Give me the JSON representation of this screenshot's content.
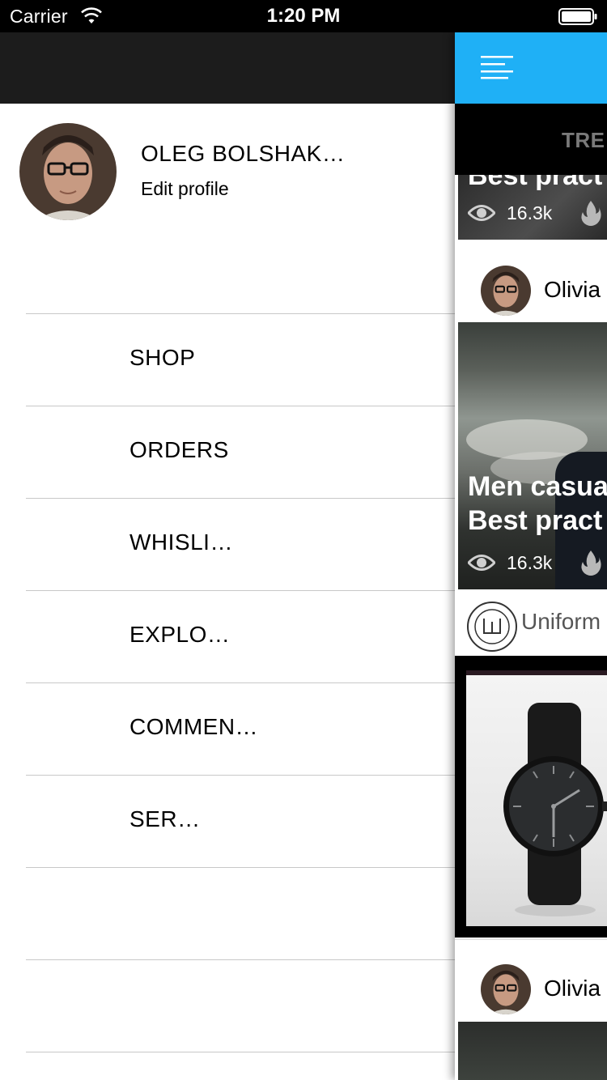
{
  "status_bar": {
    "carrier": "Carrier",
    "time": "1:20 PM"
  },
  "drawer": {
    "profile": {
      "name": "OLEG BOLSHAK…",
      "edit_label": "Edit profile"
    },
    "menu": [
      {
        "label": "SHOP"
      },
      {
        "label": "ORDERS"
      },
      {
        "label": "WHISLI…"
      },
      {
        "label": "EXPLO…"
      },
      {
        "label": "COMMEN…"
      },
      {
        "label": "SER…"
      },
      {
        "label": ""
      },
      {
        "label": ""
      }
    ]
  },
  "panel": {
    "accent_color": "#1fb0f6",
    "tab_label": "TRE",
    "feed": [
      {
        "partial_title": "Best pract",
        "views": "16.3k"
      },
      {
        "author": "Olivia",
        "title_line1": "Men casua",
        "title_line2": "Best pract",
        "views": "16.3k"
      },
      {
        "brand": "Uniform",
        "product": "watch-image"
      },
      {
        "author": "Olivia"
      }
    ]
  }
}
